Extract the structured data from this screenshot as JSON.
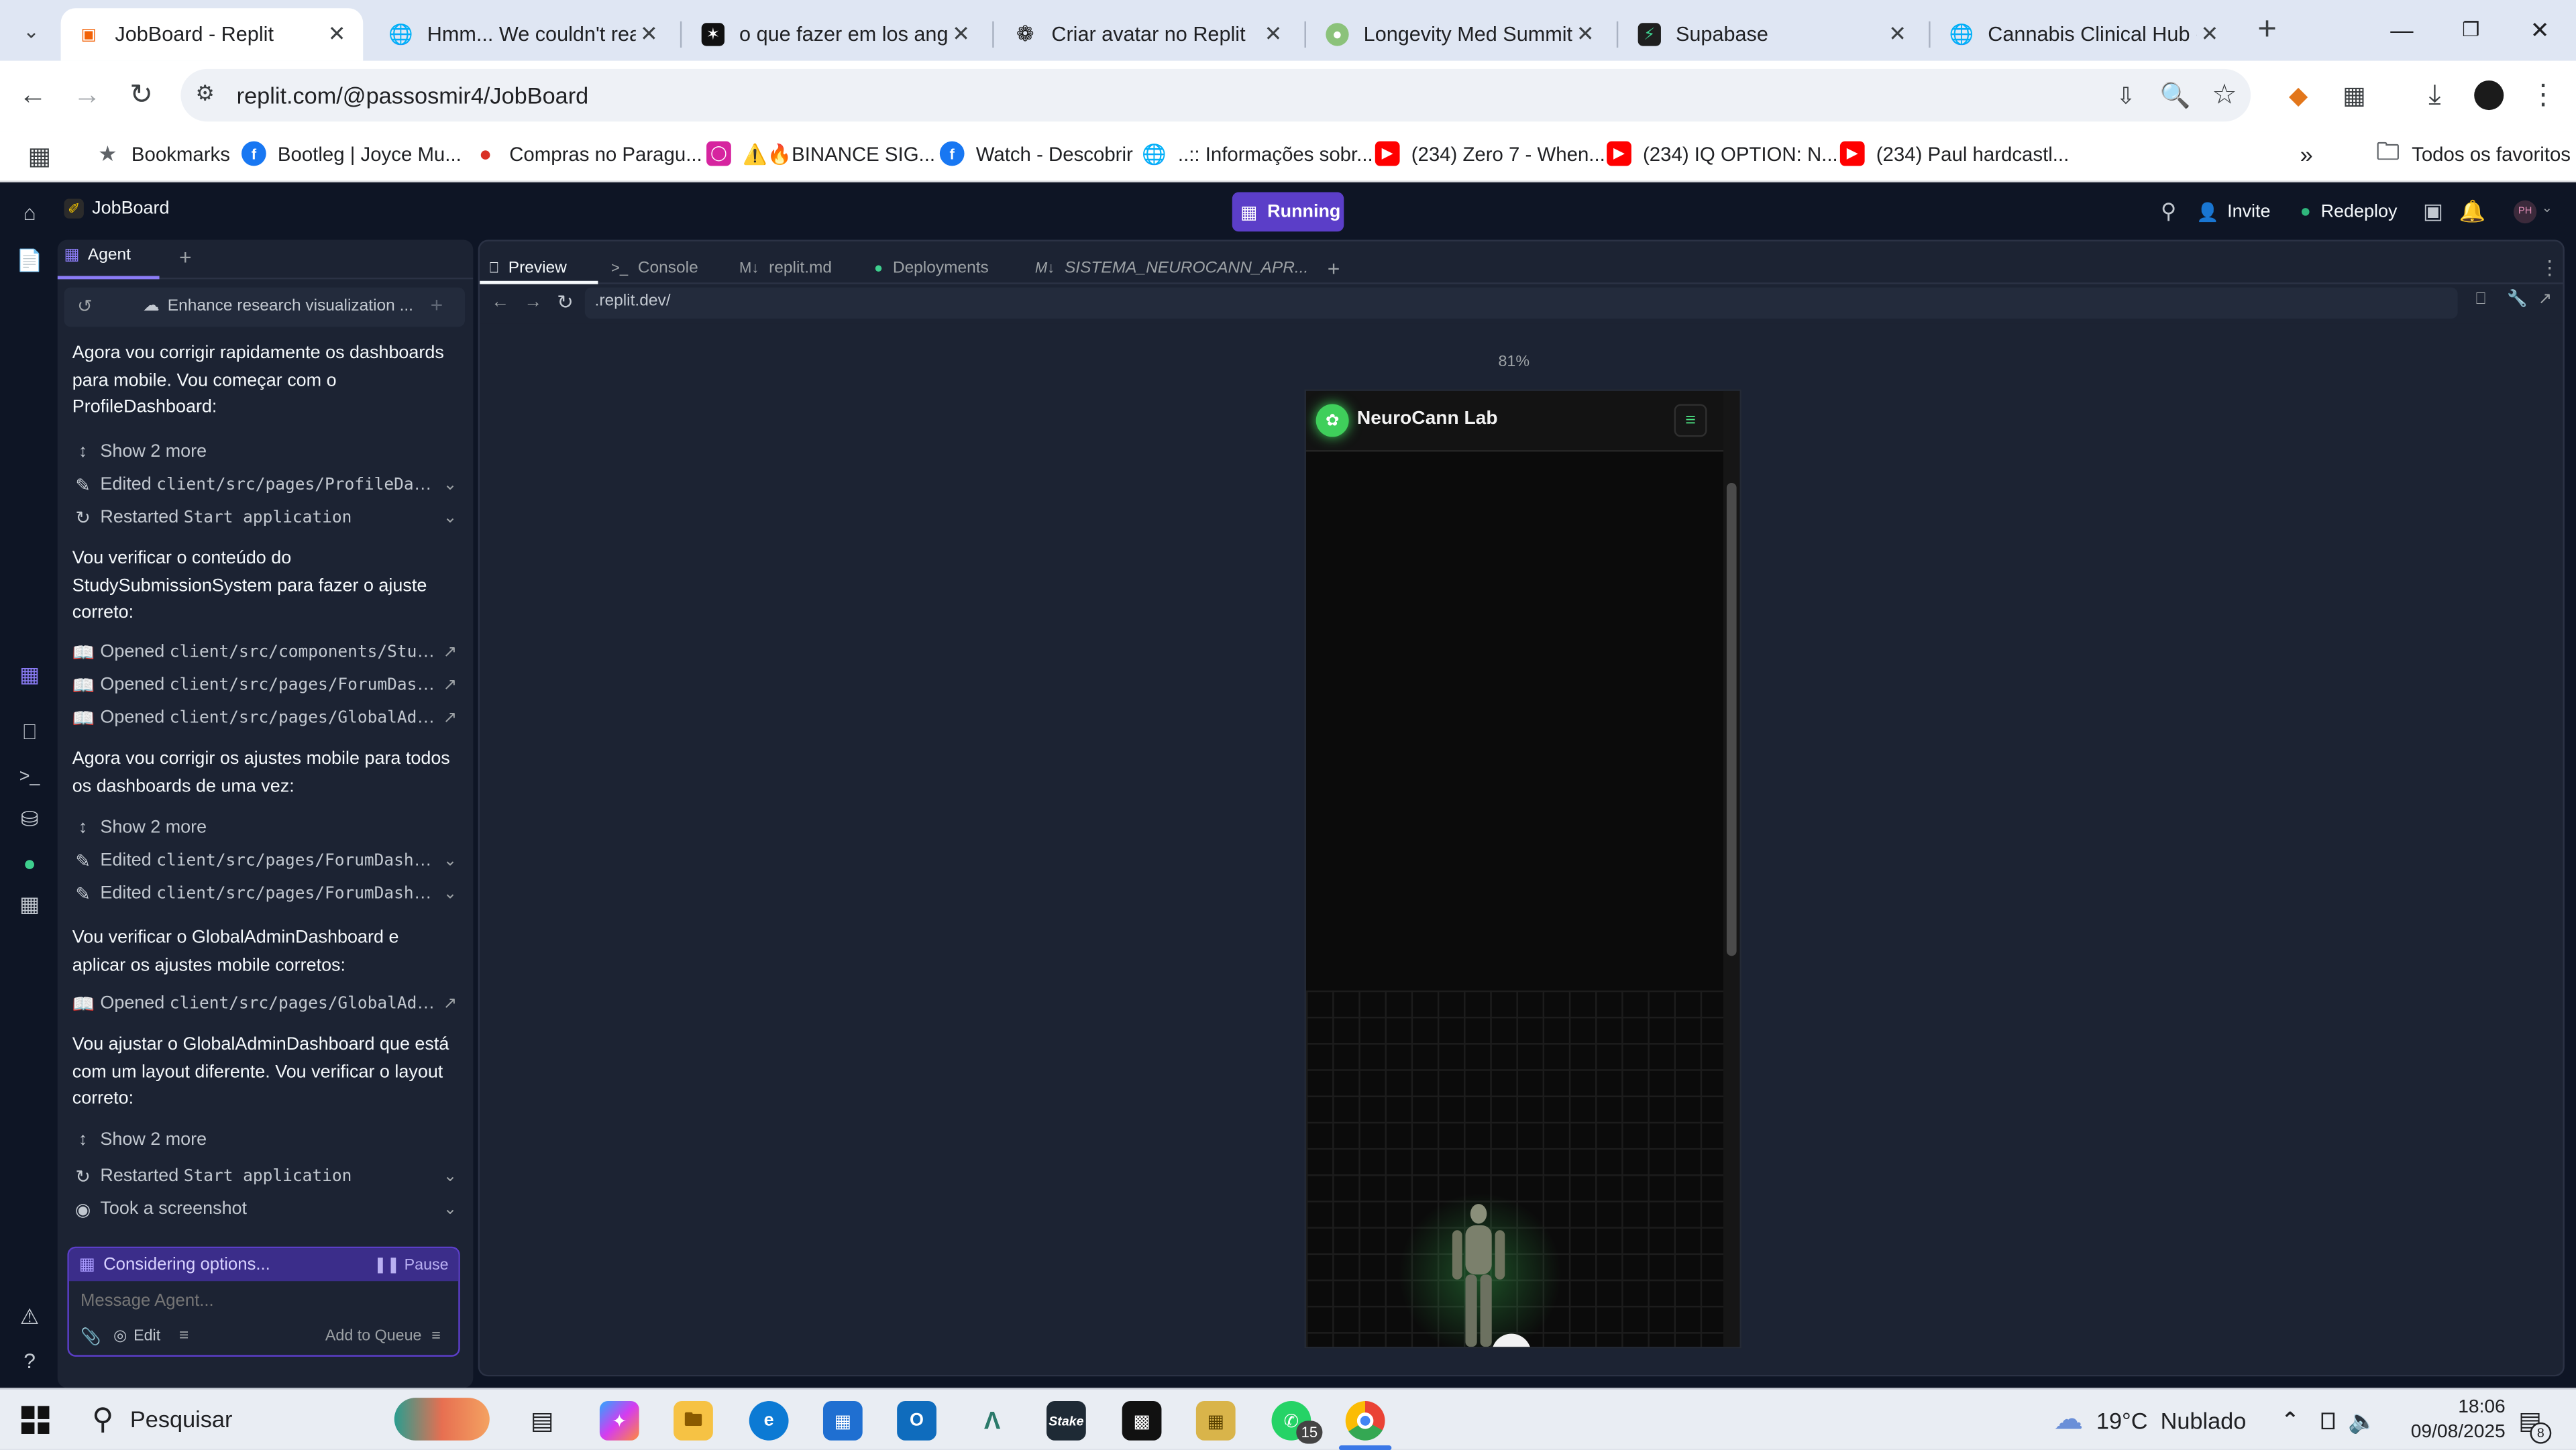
{
  "browser": {
    "tabs": [
      {
        "title": "JobBoard - Replit",
        "active": true
      },
      {
        "title": "Hmm... We couldn't reach"
      },
      {
        "title": "o que fazer em los angele"
      },
      {
        "title": "Criar avatar no Replit"
      },
      {
        "title": "Longevity Med Summit –"
      },
      {
        "title": "Supabase"
      },
      {
        "title": "Cannabis Clinical Hub - P"
      }
    ],
    "url": "replit.com/@passosmir4/JobBoard",
    "bookmarks": [
      "Bookmarks",
      "Bootleg | Joyce Mu...",
      "Compras no Paragu...",
      "⚠️🔥BINANCE SIG...",
      "Watch - Descobrir",
      "..:: Informações sobr...",
      "(234) Zero 7 - When...",
      "(234) IQ OPTION: N...",
      "(234) Paul hardcastl..."
    ],
    "all_bookmarks": "Todos os favoritos"
  },
  "replit": {
    "project_name": "JobBoard",
    "run_status": "Running",
    "invite": "Invite",
    "redeploy": "Redeploy",
    "avatar_initials": "PH",
    "agent_tab": "Agent",
    "thread_title": "Enhance research visualization ...",
    "workspace_tabs": [
      "Preview",
      "Console",
      "replit.md",
      "Deployments",
      "SISTEMA_NEUROCANN_APR..."
    ],
    "preview_url": ".replit.dev/",
    "zoom": "81%",
    "preview_app_name": "NeuroCann Lab"
  },
  "agent_feed": [
    {
      "kind": "msg",
      "text": "Agora vou corrigir rapidamente os dashboards para mobile. Vou começar com o ProfileDashboard:"
    },
    {
      "kind": "more",
      "text": "Show 2 more"
    },
    {
      "kind": "action",
      "verb": "Edited",
      "target": "client/src/pages/ProfileDashboard.tsx"
    },
    {
      "kind": "action",
      "verb": "Restarted",
      "target": "Start application"
    },
    {
      "kind": "msg",
      "text": "Vou verificar o conteúdo do StudySubmissionSystem para fazer o ajuste correto:"
    },
    {
      "kind": "open",
      "verb": "Opened",
      "target": "client/src/components/StudySubmissionSystem.tsx"
    },
    {
      "kind": "open",
      "verb": "Opened",
      "target": "client/src/pages/ForumDashboard.tsx"
    },
    {
      "kind": "open",
      "verb": "Opened",
      "target": "client/src/pages/GlobalAdminDashboard.tsx"
    },
    {
      "kind": "msg",
      "text": "Agora vou corrigir os ajustes mobile para todos os dashboards de uma vez:"
    },
    {
      "kind": "more",
      "text": "Show 2 more"
    },
    {
      "kind": "action",
      "verb": "Edited",
      "target": "client/src/pages/ForumDashboard.tsx"
    },
    {
      "kind": "action",
      "verb": "Edited",
      "target": "client/src/pages/ForumDashboard.tsx"
    },
    {
      "kind": "msg",
      "text": "Vou verificar o GlobalAdminDashboard e aplicar os ajustes mobile corretos:"
    },
    {
      "kind": "open",
      "verb": "Opened",
      "target": "client/src/pages/GlobalAdminDashboard.tsx"
    },
    {
      "kind": "msg",
      "text": "Vou ajustar o GlobalAdminDashboard que está com um layout diferente. Vou verificar o layout correto:"
    },
    {
      "kind": "more",
      "text": "Show 2 more"
    },
    {
      "kind": "action",
      "verb": "Restarted",
      "target": "Start application"
    },
    {
      "kind": "action",
      "verb": "Took a screenshot",
      "target": ""
    }
  ],
  "agent_status": {
    "text": "Considering options...",
    "pause": "Pause"
  },
  "composer": {
    "placeholder": "Message Agent...",
    "edit": "Edit",
    "queue": "Add to Queue"
  },
  "taskbar": {
    "search_placeholder": "Pesquisar",
    "weather": "19°C  Nublado",
    "time": "18:06",
    "date": "09/08/2025",
    "whatsapp_badge": "15",
    "notif_badge": "8"
  }
}
